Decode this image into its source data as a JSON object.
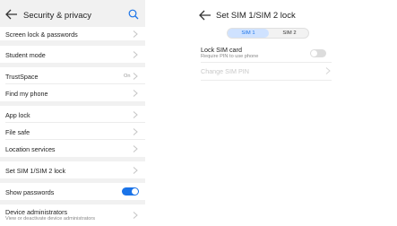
{
  "left": {
    "title": "Security & privacy",
    "items": [
      {
        "label": "Screen lock & passwords"
      },
      {
        "label": "Student mode"
      },
      {
        "label": "TrustSpace",
        "value": "On"
      },
      {
        "label": "Find my phone"
      },
      {
        "label": "App lock"
      },
      {
        "label": "File safe"
      },
      {
        "label": "Location services"
      },
      {
        "label": "Set SIM 1/SIM 2 lock"
      },
      {
        "label": "Show passwords",
        "toggle": "on"
      },
      {
        "label": "Device administrators",
        "sub": "View or deactivate device administrators"
      }
    ]
  },
  "right": {
    "title": "Set SIM 1/SIM 2 lock",
    "tabs": [
      "SIM 1",
      "SIM 2"
    ],
    "selected_tab": "SIM 1",
    "lock_sim": {
      "label": "Lock SIM card",
      "sub": "Require PIN to use phone",
      "toggle": "off"
    },
    "change_pin": "Change SIM PIN"
  },
  "colors": {
    "accent": "#1a73e8",
    "tab_selected_bg": "#cfe2ff"
  },
  "icons": [
    "back-arrow-icon",
    "search-icon",
    "chevron-right-icon"
  ]
}
